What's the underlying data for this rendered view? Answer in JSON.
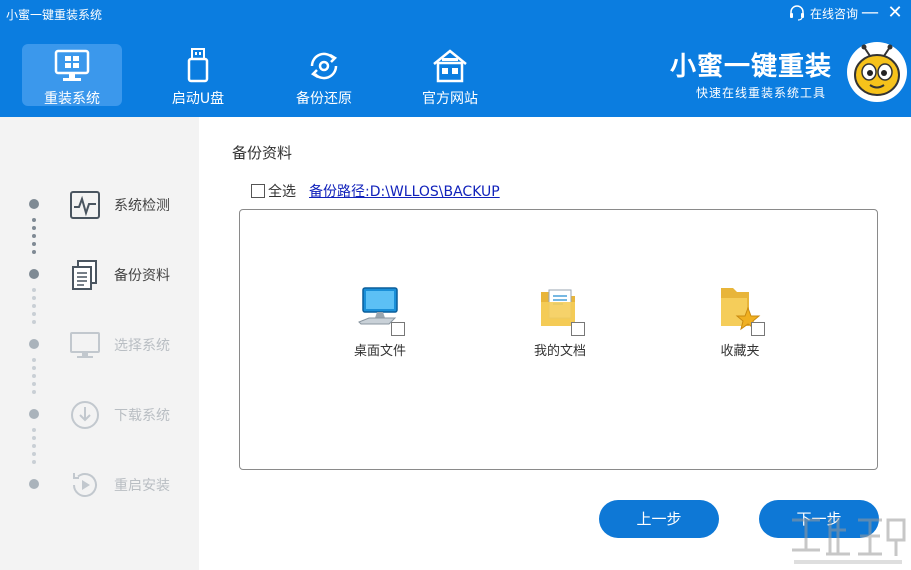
{
  "window": {
    "title": "小蜜一键重装系统",
    "consult_label": "在线咨询",
    "minimize_label": "—",
    "close_label": "✕"
  },
  "nav": {
    "tabs": [
      {
        "label": "重装系统",
        "icon": "monitor-icon",
        "active": true
      },
      {
        "label": "启动U盘",
        "icon": "usb-drive-icon",
        "active": false
      },
      {
        "label": "备份还原",
        "icon": "backup-restore-icon",
        "active": false
      },
      {
        "label": "官方网站",
        "icon": "house-icon",
        "active": false
      }
    ]
  },
  "brand": {
    "title": "小蜜一键重装",
    "subtitle": "快速在线重装系统工具",
    "logo": "bee-mascot-icon"
  },
  "steps": [
    {
      "label": "系统检测",
      "icon": "pulse-monitor-icon",
      "state": "done"
    },
    {
      "label": "备份资料",
      "icon": "document-copy-icon",
      "state": "current"
    },
    {
      "label": "选择系统",
      "icon": "monitor-icon",
      "state": "pending"
    },
    {
      "label": "下载系统",
      "icon": "download-icon",
      "state": "pending"
    },
    {
      "label": "重启安装",
      "icon": "restart-icon",
      "state": "pending"
    }
  ],
  "main": {
    "title": "备份资料",
    "select_all_label": "全选",
    "backup_path": "备份路径:D:\\WLLOS\\BACKUP",
    "items": [
      {
        "label": "桌面文件",
        "icon": "desktop-computer-icon",
        "checked": false
      },
      {
        "label": "我的文档",
        "icon": "documents-folder-icon",
        "checked": false
      },
      {
        "label": "收藏夹",
        "icon": "favorites-folder-icon",
        "checked": false
      }
    ]
  },
  "buttons": {
    "prev": "上一步",
    "next": "下一步"
  },
  "colors": {
    "header": "#0b7de0",
    "active_tab": "#3b98ec",
    "button": "#0e78d6",
    "sidebar": "#f3f3f3",
    "link": "#1122bb"
  }
}
